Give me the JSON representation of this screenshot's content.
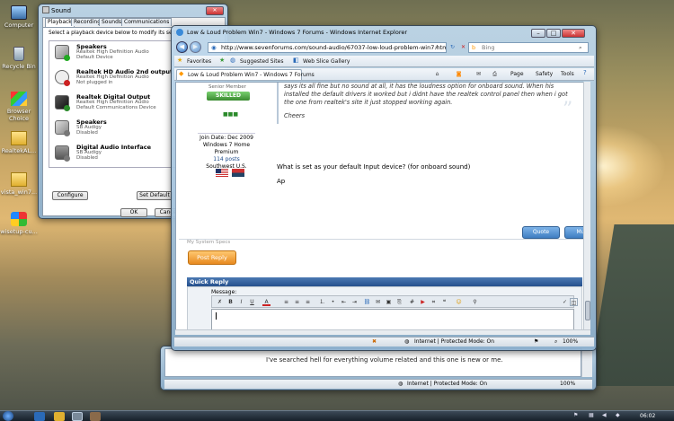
{
  "desktop": {
    "icons": [
      {
        "label": "Computer",
        "icon": "computer-icon"
      },
      {
        "label": "Recycle Bin",
        "icon": "recycle-bin-icon"
      },
      {
        "label": "Browser Choice",
        "icon": "browser-choice-icon"
      },
      {
        "label": "RealtekAL...",
        "icon": "folder-icon"
      },
      {
        "label": "vista_win7...",
        "icon": "folder-icon"
      },
      {
        "label": "wisetup-cu...",
        "icon": "windows-setup-icon"
      }
    ]
  },
  "sound_dialog": {
    "title": "Sound",
    "tabs": [
      "Playback",
      "Recording",
      "Sounds",
      "Communications"
    ],
    "instruction": "Select a playback device below to modify its settin",
    "devices": [
      {
        "name": "Speakers",
        "lines": [
          "Realtek High Definition Audio",
          "Default Device"
        ],
        "icon": "speaker-icon",
        "badge": "check"
      },
      {
        "name": "Realtek HD Audio 2nd output",
        "lines": [
          "Realtek High Definition Audio",
          "Not plugged in"
        ],
        "icon": "headphones-icon",
        "badge": "red"
      },
      {
        "name": "Realtek Digital Output",
        "lines": [
          "Realtek High Definition Audio",
          "Default Communications Device"
        ],
        "icon": "digital-output-icon",
        "badge": "phone"
      },
      {
        "name": "Speakers",
        "lines": [
          "SB Audigy",
          "Disabled"
        ],
        "icon": "speaker-icon",
        "badge": "down"
      },
      {
        "name": "Digital Audio Interface",
        "lines": [
          "SB Audigy",
          "Disabled"
        ],
        "icon": "digital-interface-icon",
        "badge": "down"
      }
    ],
    "buttons": {
      "configure": "Configure",
      "set_default": "Set Default",
      "ok": "OK",
      "cancel": "Cance"
    }
  },
  "ie_main": {
    "title": "Low & Loud Problem Win7 - Windows 7 Forums - Windows Internet Explorer",
    "url": "http://www.sevenforums.com/sound-audio/67037-low-loud-problem-win7.htm",
    "search_placeholder": "Bing",
    "favorites": "Favorites",
    "suggested_sites": "Suggested Sites",
    "web_slice": "Web Slice Gallery",
    "tab_title": "Low & Loud Problem Win7 - Windows 7 Forums",
    "menu": {
      "page": "Page",
      "safety": "Safety",
      "tools": "Tools"
    },
    "post": {
      "rank": "Senior Member",
      "badge": "SKILLED",
      "rep": "■■■",
      "join_date": "Join Date: Dec 2009",
      "os": "Windows 7 Home Premium",
      "posts": "114 posts",
      "location": "Southwest U.S.",
      "quote_lines": [
        "says its all fine but no sound at all, it has the loudness option for onboard sound. When his",
        "installed the default drivers it worked but i didnt have the realtek control panel then when i got",
        "the one from realtek's site it just stopped working again."
      ],
      "cheers": "Cheers",
      "question": "What is set as your default Input device? (for onboard sound)",
      "signature": "Ap",
      "system_specs": "My System Specs",
      "quote_button": "Quote",
      "multi_button": "Mu",
      "post_reply": "Post Reply"
    },
    "quick_reply": {
      "title": "Quick Reply",
      "message_label": "Message:"
    },
    "status": {
      "zone": "Internet | Protected Mode: On",
      "zoom": "100%"
    }
  },
  "ie_back": {
    "text": "I've searched hell for everything volume related and this one is new or me.",
    "status": {
      "zone": "Internet | Protected Mode: On",
      "zoom": "100%"
    }
  },
  "taskbar": {
    "clock": "06:02"
  },
  "colors": {
    "accent": "#2a6ab8",
    "forum_blue": "#1c4a8a",
    "post_reply": "#f0a030",
    "skilled_badge": "#46a03a"
  }
}
